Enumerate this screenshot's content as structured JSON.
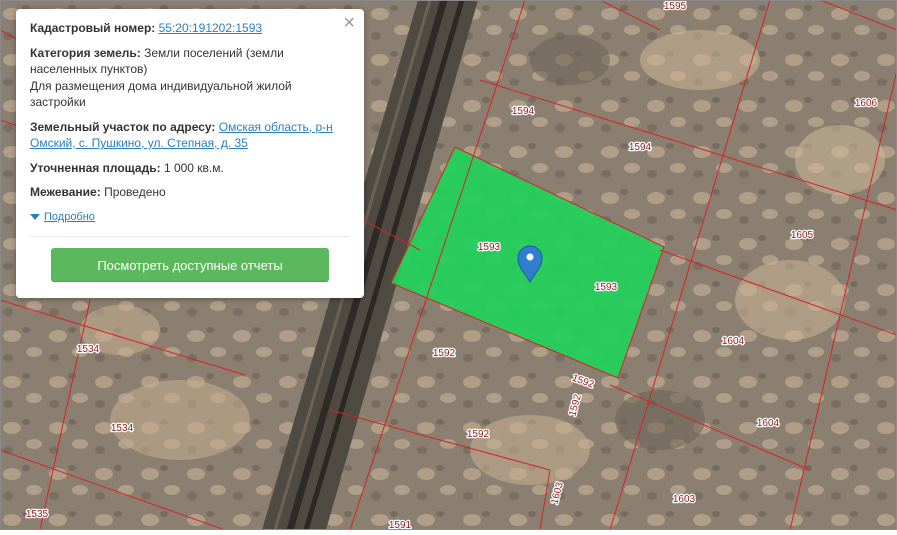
{
  "map": {
    "plot_labels": [
      "1595",
      "1606",
      "1594",
      "1594",
      "1605",
      "1593",
      "1593",
      "1604",
      "1534",
      "1592",
      "1592",
      "1534",
      "1592",
      "1604",
      "1592",
      "1603",
      "1603",
      "1535",
      "1591"
    ],
    "highlight_color": "#1fd15a",
    "boundary_color": "#d62222",
    "marker_color": "#2f7fcf",
    "marker_icon": "map-pin-icon"
  },
  "popup": {
    "cadastral_label": "Кадастровый номер:",
    "cadastral_value": "55:20:191202:1593",
    "category_label": "Категория земель:",
    "category_value": "Земли поселений (земли населенных пунктов)",
    "usage_value": "Для размещения дома индивидуальной жилой застройки",
    "address_label": "Земельный участок по адресу:",
    "address_value": "Омская область, р-н Омский, с. Пушкино, ул. Степная, д. 35",
    "area_label": "Уточненная площадь:",
    "area_value": "1 000 кв.м.",
    "survey_label": "Межевание:",
    "survey_value": "Проведено",
    "more_link": "Подробно",
    "reports_button": "Посмотреть доступные отчеты",
    "close_icon": "×"
  }
}
